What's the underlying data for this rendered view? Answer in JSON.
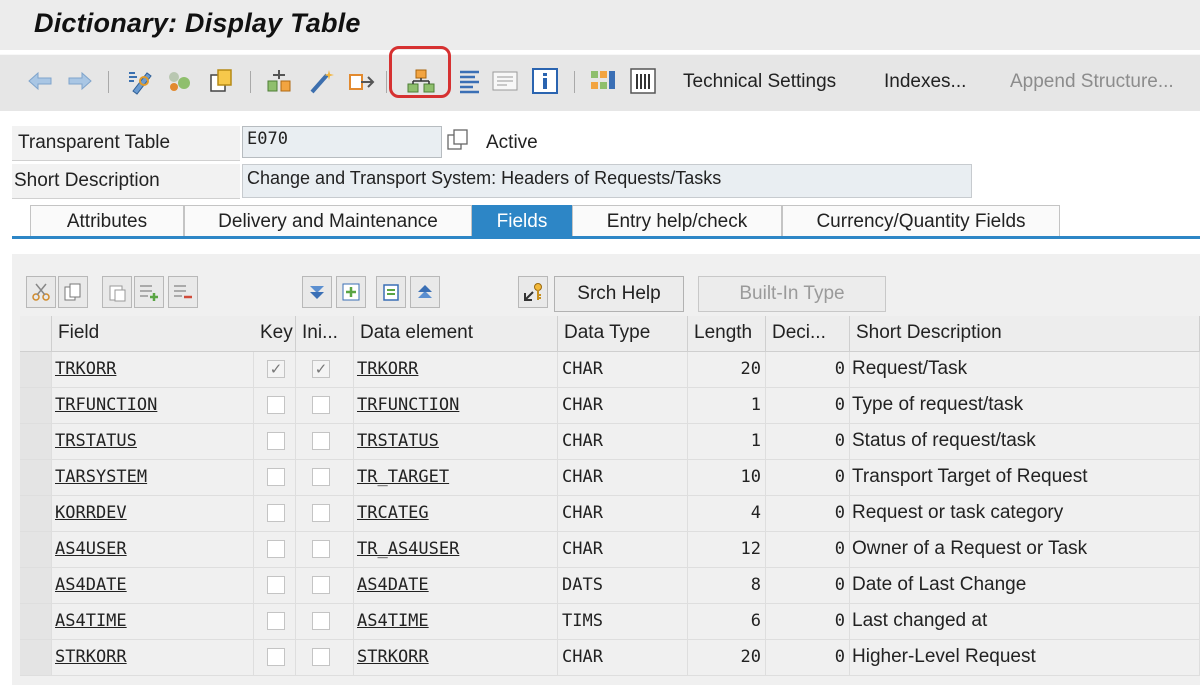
{
  "window": {
    "title": "Dictionary: Display Table"
  },
  "toolbar": {
    "icons": [
      "arrow-left-icon",
      "arrow-right-icon",
      "display-change-icon",
      "other-object-icon",
      "check-icon",
      "activate-icon",
      "where-used-icon",
      "magic-wand-icon",
      "object-list-icon",
      "hierarchy-icon",
      "outline-icon",
      "docs-icon",
      "info-icon",
      "table-contents-icon",
      "grid-icon"
    ],
    "technical_settings": "Technical Settings",
    "indexes": "Indexes...",
    "append_structure": "Append Structure..."
  },
  "header": {
    "table_type_label": "Transparent Table",
    "table_name": "E070",
    "status": "Active",
    "short_description_label": "Short Description",
    "short_description": "Change and Transport System: Headers of Requests/Tasks"
  },
  "tabs": [
    {
      "label": "Attributes",
      "active": false
    },
    {
      "label": "Delivery and Maintenance",
      "active": false
    },
    {
      "label": "Fields",
      "active": true
    },
    {
      "label": "Entry help/check",
      "active": false
    },
    {
      "label": "Currency/Quantity Fields",
      "active": false
    }
  ],
  "grid_toolbar": {
    "srch_help": "Srch Help",
    "built_in_type": "Built-In Type"
  },
  "columns": [
    "Field",
    "Key",
    "Ini...",
    "Data element",
    "Data Type",
    "Length",
    "Deci...",
    "Short Description"
  ],
  "rows": [
    {
      "field": "TRKORR",
      "key": true,
      "init": true,
      "data_element": "TRKORR",
      "data_type": "CHAR",
      "length": "20",
      "decimals": "0",
      "description": "Request/Task"
    },
    {
      "field": "TRFUNCTION",
      "key": false,
      "init": false,
      "data_element": "TRFUNCTION",
      "data_type": "CHAR",
      "length": "1",
      "decimals": "0",
      "description": "Type of request/task"
    },
    {
      "field": "TRSTATUS",
      "key": false,
      "init": false,
      "data_element": "TRSTATUS",
      "data_type": "CHAR",
      "length": "1",
      "decimals": "0",
      "description": "Status of request/task"
    },
    {
      "field": "TARSYSTEM",
      "key": false,
      "init": false,
      "data_element": "TR_TARGET",
      "data_type": "CHAR",
      "length": "10",
      "decimals": "0",
      "description": "Transport Target of Request"
    },
    {
      "field": "KORRDEV",
      "key": false,
      "init": false,
      "data_element": "TRCATEG",
      "data_type": "CHAR",
      "length": "4",
      "decimals": "0",
      "description": "Request or task category"
    },
    {
      "field": "AS4USER",
      "key": false,
      "init": false,
      "data_element": "TR_AS4USER",
      "data_type": "CHAR",
      "length": "12",
      "decimals": "0",
      "description": "Owner of a Request or Task"
    },
    {
      "field": "AS4DATE",
      "key": false,
      "init": false,
      "data_element": "AS4DATE",
      "data_type": "DATS",
      "length": "8",
      "decimals": "0",
      "description": "Date of Last Change"
    },
    {
      "field": "AS4TIME",
      "key": false,
      "init": false,
      "data_element": "AS4TIME",
      "data_type": "TIMS",
      "length": "6",
      "decimals": "0",
      "description": "Last changed at"
    },
    {
      "field": "STRKORR",
      "key": false,
      "init": false,
      "data_element": "STRKORR",
      "data_type": "CHAR",
      "length": "20",
      "decimals": "0",
      "description": "Higher-Level Request"
    }
  ],
  "colors": {
    "accent": "#2d86c6",
    "highlight": "#d63131"
  }
}
